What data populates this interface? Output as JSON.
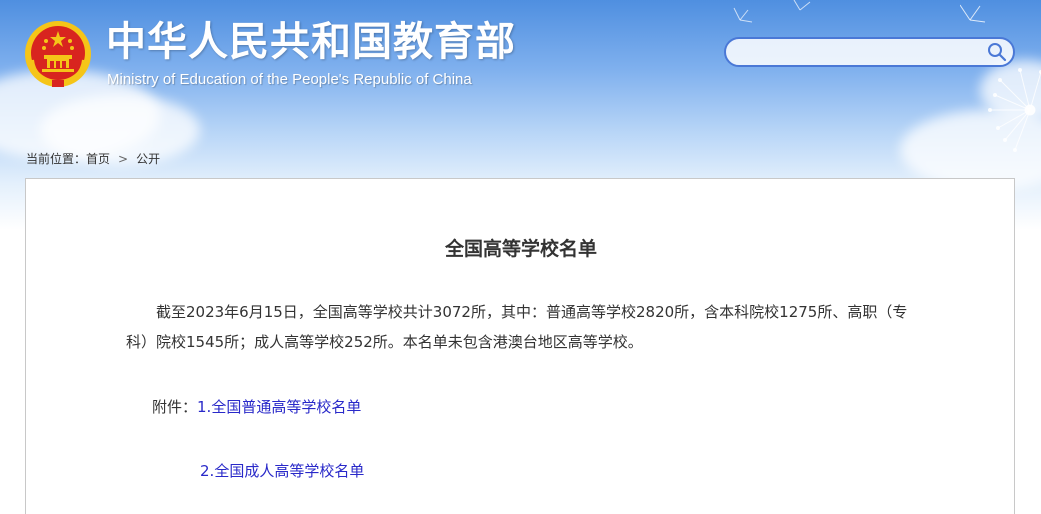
{
  "header": {
    "site_title": "中华人民共和国教育部",
    "site_subtitle": "Ministry of Education of the People's Republic of China",
    "colors": {
      "sky": "#4f8fe0",
      "emblem_red": "#d8241f",
      "emblem_gold": "#f5c518"
    }
  },
  "search": {
    "placeholder": "",
    "value": "",
    "icon": "search-icon",
    "border_color": "#4a78d6"
  },
  "breadcrumb": {
    "prefix": "当前位置：",
    "home": "首页",
    "separator": ">",
    "current": "公开"
  },
  "article": {
    "title": "全国高等学校名单",
    "paragraph": "截至2023年6月15日，全国高等学校共计3072所，其中：普通高等学校2820所，含本科院校1275所、高职（专科）院校1545所；成人高等学校252所。本名单未包含港澳台地区高等学校。",
    "attachments_label": "附件：",
    "attachments": [
      {
        "number": "1.",
        "text": "全国普通高等学校名单"
      },
      {
        "number": "2.",
        "text": "全国成人高等学校名单"
      }
    ],
    "link_color": "#2929c9"
  }
}
